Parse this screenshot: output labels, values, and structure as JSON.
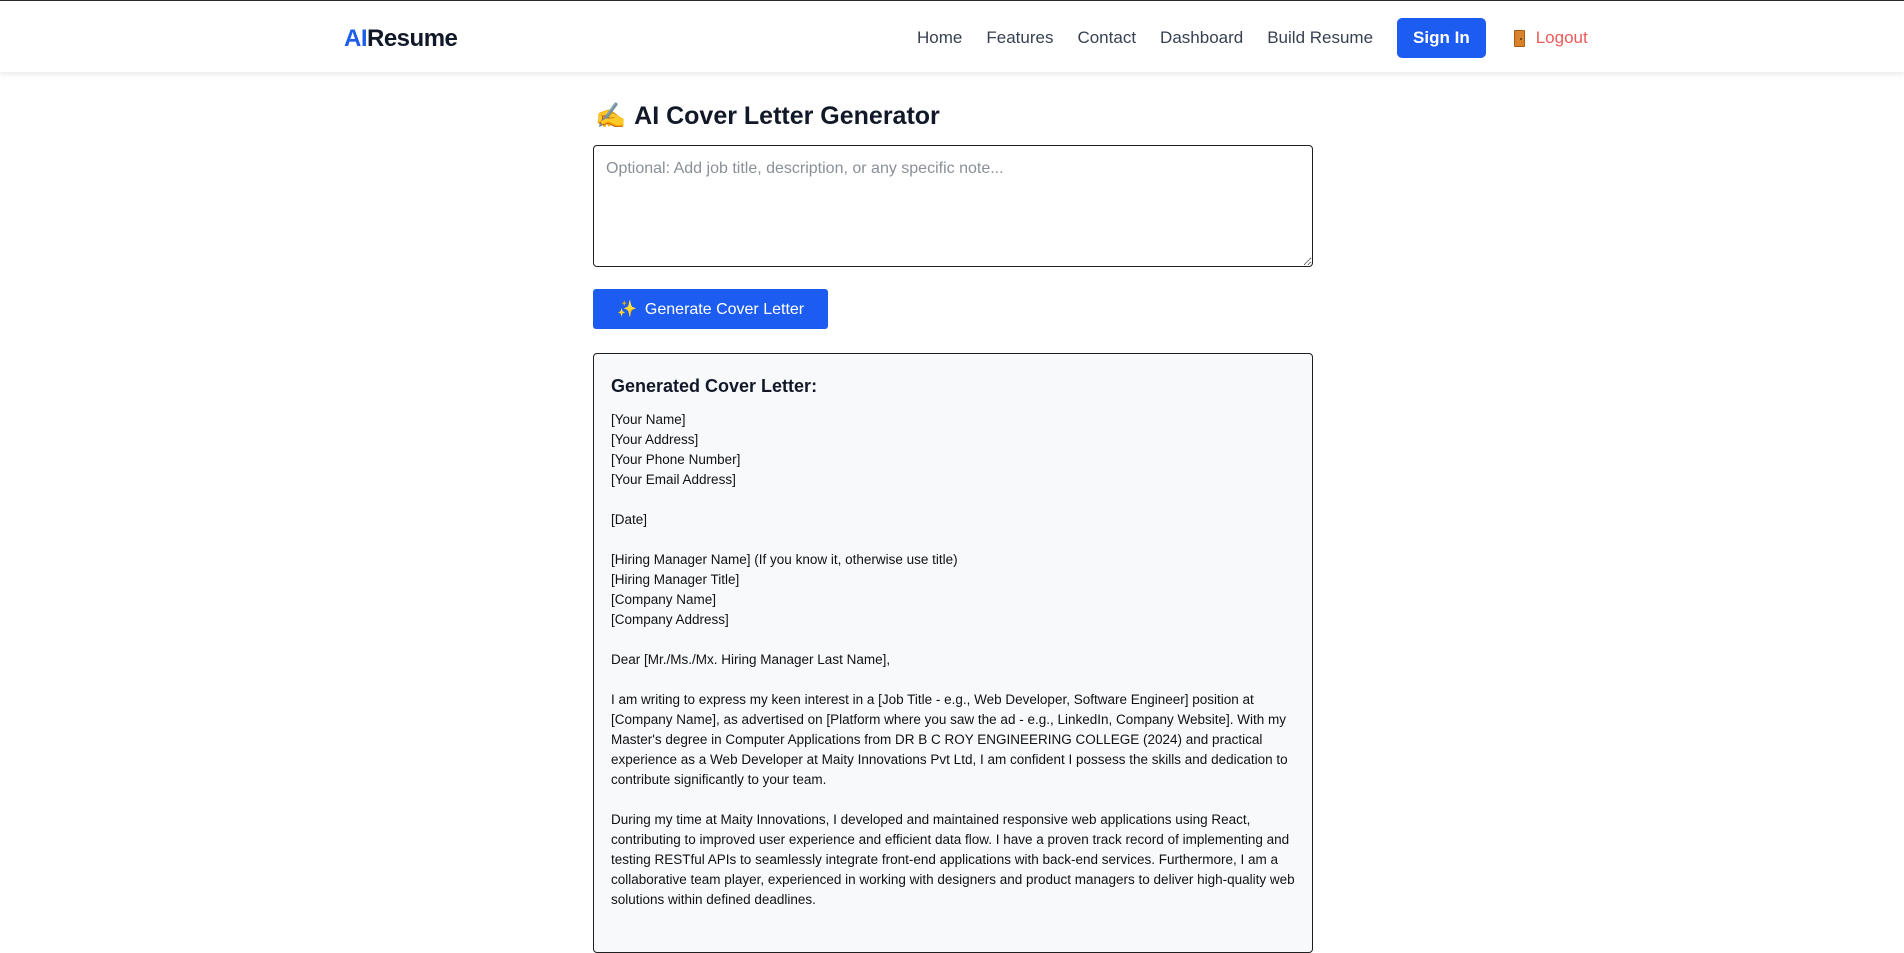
{
  "brand": {
    "ai": "AI",
    "resume": "Resume"
  },
  "nav": {
    "links": [
      "Home",
      "Features",
      "Contact",
      "Dashboard",
      "Build Resume"
    ],
    "signin_label": "Sign In",
    "logout_label": "Logout",
    "logout_icon": "door-icon"
  },
  "colors": {
    "primary": "#1d5cf0",
    "logout": "#ef5a5a",
    "result_bg": "#f8f9fb"
  },
  "page": {
    "title_emoji": "✍️",
    "title": "AI Cover Letter Generator"
  },
  "note_input": {
    "value": "",
    "placeholder": "Optional: Add job title, description, or any specific note..."
  },
  "generate_button": {
    "icon": "✨",
    "label": "Generate Cover Letter"
  },
  "result": {
    "heading": "Generated Cover Letter:",
    "letter": "[Your Name]\n[Your Address]\n[Your Phone Number]\n[Your Email Address]\n\n[Date]\n\n[Hiring Manager Name] (If you know it, otherwise use title)\n[Hiring Manager Title]\n[Company Name]\n[Company Address]\n\nDear [Mr./Ms./Mx. Hiring Manager Last Name],\n\nI am writing to express my keen interest in a [Job Title - e.g., Web Developer, Software Engineer] position at [Company Name], as advertised on [Platform where you saw the ad - e.g., LinkedIn, Company Website]. With my Master's degree in Computer Applications from DR B C ROY ENGINEERING COLLEGE (2024) and practical experience as a Web Developer at Maity Innovations Pvt Ltd, I am confident I possess the skills and dedication to contribute significantly to your team.\n\nDuring my time at Maity Innovations, I developed and maintained responsive web applications using React, contributing to improved user experience and efficient data flow. I have a proven track record of implementing and testing RESTful APIs to seamlessly integrate front-end applications with back-end services. Furthermore, I am a collaborative team player, experienced in working with designers and product managers to deliver high-quality web solutions within defined deadlines."
  }
}
